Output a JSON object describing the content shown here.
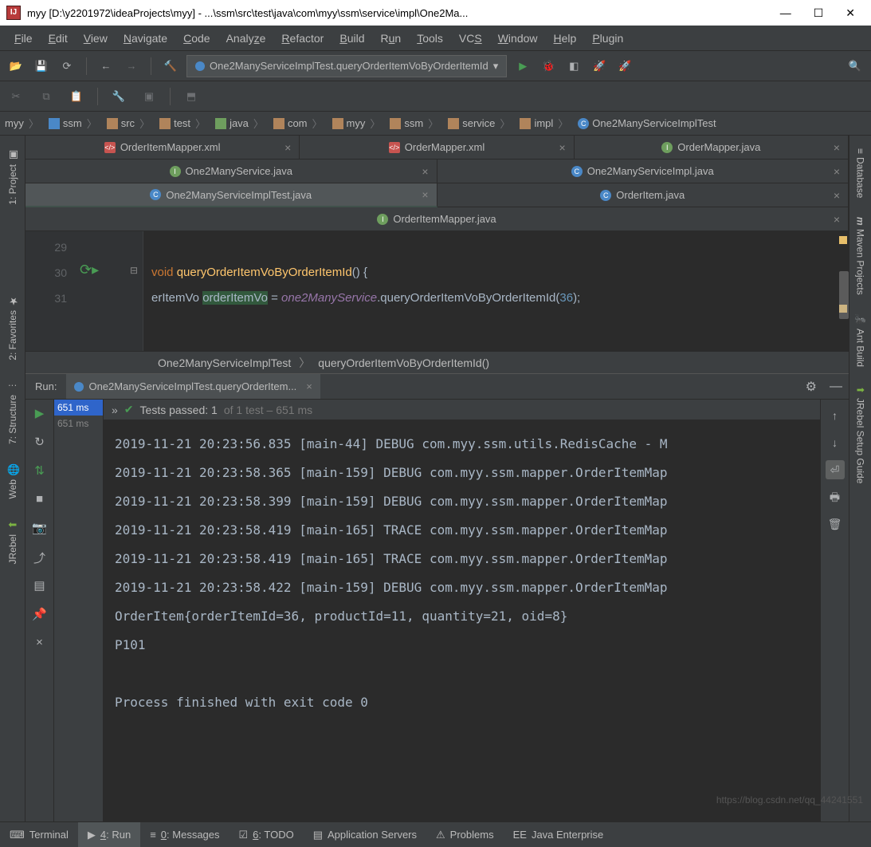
{
  "titlebar": {
    "icon_text": "IJ",
    "title": "myy [D:\\y2201972\\ideaProjects\\myy] - ...\\ssm\\src\\test\\java\\com\\myy\\ssm\\service\\impl\\One2Ma..."
  },
  "menu": [
    "File",
    "Edit",
    "View",
    "Navigate",
    "Code",
    "Analyze",
    "Refactor",
    "Build",
    "Run",
    "Tools",
    "VCS",
    "Window",
    "Help",
    "Plugin"
  ],
  "toolbar": {
    "runconfig": "One2ManyServiceImplTest.queryOrderItemVoByOrderItemId"
  },
  "breadcrumbs": [
    "myy",
    "ssm",
    "src",
    "test",
    "java",
    "com",
    "myy",
    "ssm",
    "service",
    "impl",
    "One2ManyServiceImplTest"
  ],
  "tabs": {
    "row1": [
      {
        "label": "OrderItemMapper.xml",
        "type": "xml"
      },
      {
        "label": "OrderMapper.xml",
        "type": "xml"
      },
      {
        "label": "OrderMapper.java",
        "type": "i-green"
      }
    ],
    "row2": [
      {
        "label": "One2ManyService.java",
        "type": "i-green"
      },
      {
        "label": "One2ManyServiceImpl.java",
        "type": "c-blue"
      }
    ],
    "row3": [
      {
        "label": "One2ManyServiceImplTest.java",
        "type": "c-blue",
        "active": true
      },
      {
        "label": "OrderItem.java",
        "type": "c-blue"
      }
    ],
    "row4": [
      {
        "label": "OrderItemMapper.java",
        "type": "i-green"
      }
    ]
  },
  "editor": {
    "lines": [
      "29",
      "30",
      "31"
    ],
    "code_l30_kw": "void ",
    "code_l30_method": "queryOrderItemVoByOrderItemId",
    "code_l30_rest": "() {",
    "code_l31_a": "erItemVo ",
    "code_l31_b": "orderItemVo",
    "code_l31_c": " = ",
    "code_l31_d": "one2ManyService",
    "code_l31_e": ".",
    "code_l31_f": "queryOrderItemVoByOrderItemId",
    "code_l31_g": "(",
    "code_l31_num": "36",
    "code_l31_h": ");"
  },
  "navpath": {
    "a": "One2ManyServiceImplTest",
    "b": "queryOrderItemVoByOrderItemId()"
  },
  "run": {
    "label": "Run:",
    "tab": "One2ManyServiceImplTest.queryOrderItem...",
    "tests_passed": "Tests passed: ",
    "tests_count": "1",
    "tests_of": " of 1 test",
    "tests_time": " – 651 ms",
    "tree": [
      "651 ms",
      "651 ms"
    ],
    "console": "2019-11-21 20:23:56.835 [main-44] DEBUG com.myy.ssm.utils.RedisCache - M\n2019-11-21 20:23:58.365 [main-159] DEBUG com.myy.ssm.mapper.OrderItemMap\n2019-11-21 20:23:58.399 [main-159] DEBUG com.myy.ssm.mapper.OrderItemMap\n2019-11-21 20:23:58.419 [main-165] TRACE com.myy.ssm.mapper.OrderItemMap\n2019-11-21 20:23:58.419 [main-165] TRACE com.myy.ssm.mapper.OrderItemMap\n2019-11-21 20:23:58.422 [main-159] DEBUG com.myy.ssm.mapper.OrderItemMap\nOrderItem{orderItemId=36, productId=11, quantity=21, oid=8}\nP101\n\nProcess finished with exit code 0"
  },
  "leftstrip": [
    {
      "label": "1: Project"
    },
    {
      "label": "2: Favorites"
    },
    {
      "label": "7: Structure"
    },
    {
      "label": "Web"
    },
    {
      "label": "JRebel"
    }
  ],
  "rightstrip": [
    {
      "label": "Database"
    },
    {
      "label": "Maven Projects"
    },
    {
      "label": "Ant Build"
    },
    {
      "label": "JRebel Setup Guide"
    }
  ],
  "bottombar": [
    {
      "label": "Terminal"
    },
    {
      "label": "4: Run",
      "active": true,
      "u": "4"
    },
    {
      "label": "0: Messages",
      "u": "0"
    },
    {
      "label": "6: TODO",
      "u": "6"
    },
    {
      "label": "Application Servers"
    },
    {
      "label": "Problems"
    },
    {
      "label": "Java Enterprise"
    }
  ],
  "watermark": "https://blog.csdn.net/qq_44241551"
}
